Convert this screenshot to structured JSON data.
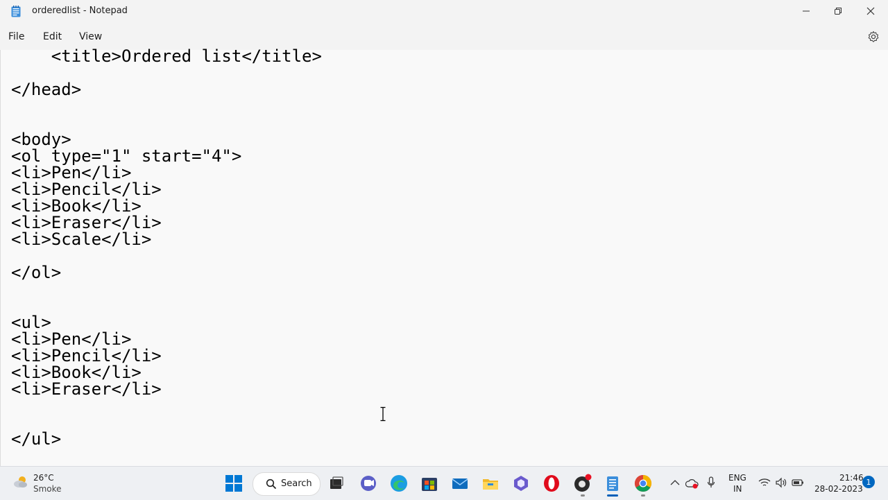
{
  "window": {
    "title": "orderedlist - Notepad",
    "minimize_icon": "minimize-icon",
    "maximize_icon": "restore-icon",
    "close_icon": "close-icon"
  },
  "menu": {
    "items": [
      "File",
      "Edit",
      "View"
    ],
    "settings_icon": "gear-icon"
  },
  "editor": {
    "content": "    <title>Ordered list</title>\n\n</head>\n\n\n<body>\n<ol type=\"1\" start=\"4\">\n<li>Pen</li>\n<li>Pencil</li>\n<li>Book</li>\n<li>Eraser</li>\n<li>Scale</li>\n\n</ol>\n\n\n<ul>\n<li>Pen</li>\n<li>Pencil</li>\n<li>Book</li>\n<li>Eraser</li>\n\n\n</ul>"
  },
  "taskbar": {
    "weather": {
      "temp": "26°C",
      "condition": "Smoke"
    },
    "search_label": "Search",
    "tray": {
      "language": "ENG",
      "region": "IN",
      "time": "21:46",
      "date": "28-02-2023",
      "notification_count": "1"
    }
  }
}
